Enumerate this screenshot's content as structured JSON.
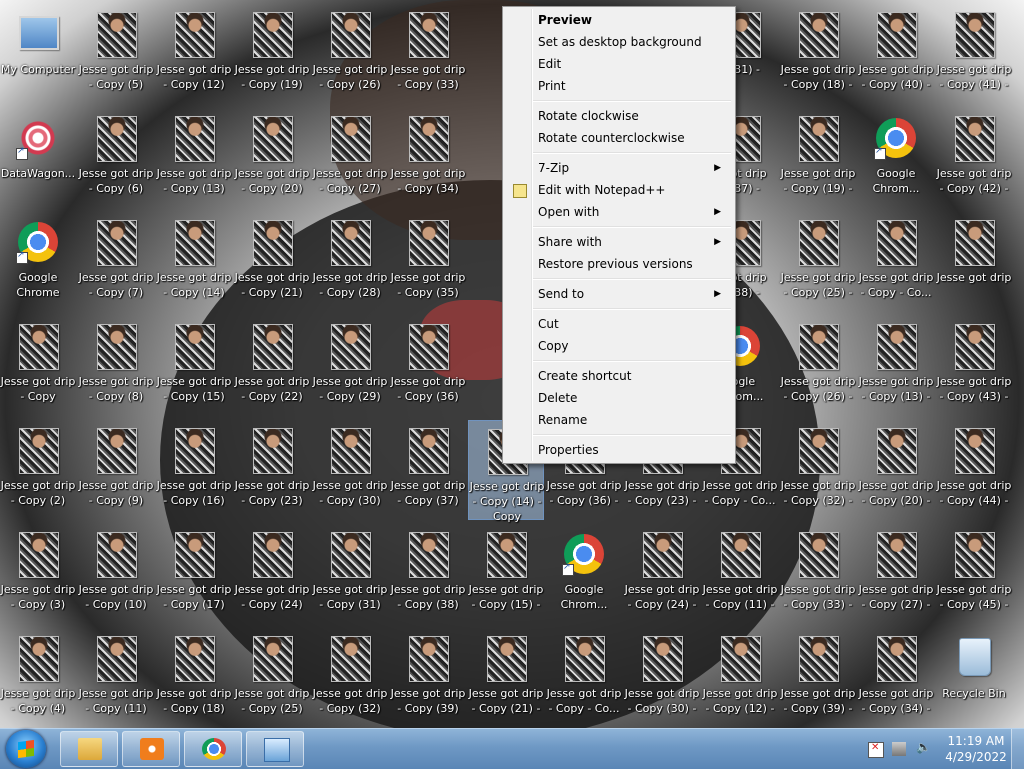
{
  "desktop": {
    "icons": [
      {
        "label": "My Computer",
        "kind": "pc",
        "col": 0,
        "row": 0
      },
      {
        "label": "DataWagon...",
        "kind": "dw",
        "col": 0,
        "row": 1,
        "shortcut": true
      },
      {
        "label": "Google\nChrome",
        "kind": "chrome",
        "col": 0,
        "row": 2,
        "shortcut": true
      },
      {
        "label": "Jesse got drip\n- Copy",
        "kind": "photo",
        "col": 0,
        "row": 3
      },
      {
        "label": "Jesse got drip\n- Copy (2)",
        "kind": "photo",
        "col": 0,
        "row": 4
      },
      {
        "label": "Jesse got drip\n- Copy (3)",
        "kind": "photo",
        "col": 0,
        "row": 5
      },
      {
        "label": "Jesse got drip\n- Copy (4)",
        "kind": "photo",
        "col": 0,
        "row": 6
      },
      {
        "label": "Jesse got drip\n- Copy (5)",
        "kind": "photo",
        "col": 1,
        "row": 0
      },
      {
        "label": "Jesse got drip\n- Copy (6)",
        "kind": "photo",
        "col": 1,
        "row": 1
      },
      {
        "label": "Jesse got drip\n- Copy (7)",
        "kind": "photo",
        "col": 1,
        "row": 2
      },
      {
        "label": "Jesse got drip\n- Copy (8)",
        "kind": "photo",
        "col": 1,
        "row": 3
      },
      {
        "label": "Jesse got drip\n- Copy (9)",
        "kind": "photo",
        "col": 1,
        "row": 4
      },
      {
        "label": "Jesse got drip\n- Copy (10)",
        "kind": "photo",
        "col": 1,
        "row": 5
      },
      {
        "label": "Jesse got drip\n- Copy (11)",
        "kind": "photo",
        "col": 1,
        "row": 6
      },
      {
        "label": "Jesse got drip\n- Copy (12)",
        "kind": "photo",
        "col": 2,
        "row": 0
      },
      {
        "label": "Jesse got drip\n- Copy (13)",
        "kind": "photo",
        "col": 2,
        "row": 1
      },
      {
        "label": "Jesse got drip\n- Copy (14)",
        "kind": "photo",
        "col": 2,
        "row": 2
      },
      {
        "label": "Jesse got drip\n- Copy (15)",
        "kind": "photo",
        "col": 2,
        "row": 3
      },
      {
        "label": "Jesse got drip\n- Copy (16)",
        "kind": "photo",
        "col": 2,
        "row": 4
      },
      {
        "label": "Jesse got drip\n- Copy (17)",
        "kind": "photo",
        "col": 2,
        "row": 5
      },
      {
        "label": "Jesse got drip\n- Copy (18)",
        "kind": "photo",
        "col": 2,
        "row": 6
      },
      {
        "label": "Jesse got drip\n- Copy (19)",
        "kind": "photo",
        "col": 3,
        "row": 0
      },
      {
        "label": "Jesse got drip\n- Copy (20)",
        "kind": "photo",
        "col": 3,
        "row": 1
      },
      {
        "label": "Jesse got drip\n- Copy (21)",
        "kind": "photo",
        "col": 3,
        "row": 2
      },
      {
        "label": "Jesse got drip\n- Copy (22)",
        "kind": "photo",
        "col": 3,
        "row": 3
      },
      {
        "label": "Jesse got drip\n- Copy (23)",
        "kind": "photo",
        "col": 3,
        "row": 4
      },
      {
        "label": "Jesse got drip\n- Copy (24)",
        "kind": "photo",
        "col": 3,
        "row": 5
      },
      {
        "label": "Jesse got drip\n- Copy (25)",
        "kind": "photo",
        "col": 3,
        "row": 6
      },
      {
        "label": "Jesse got drip\n- Copy (26)",
        "kind": "photo",
        "col": 4,
        "row": 0
      },
      {
        "label": "Jesse got drip\n- Copy (27)",
        "kind": "photo",
        "col": 4,
        "row": 1
      },
      {
        "label": "Jesse got drip\n- Copy (28)",
        "kind": "photo",
        "col": 4,
        "row": 2
      },
      {
        "label": "Jesse got drip\n- Copy (29)",
        "kind": "photo",
        "col": 4,
        "row": 3
      },
      {
        "label": "Jesse got drip\n- Copy (30)",
        "kind": "photo",
        "col": 4,
        "row": 4
      },
      {
        "label": "Jesse got drip\n- Copy (31)",
        "kind": "photo",
        "col": 4,
        "row": 5
      },
      {
        "label": "Jesse got drip\n- Copy (32)",
        "kind": "photo",
        "col": 4,
        "row": 6
      },
      {
        "label": "Jesse got drip\n- Copy (33)",
        "kind": "photo",
        "col": 5,
        "row": 0
      },
      {
        "label": "Jesse got drip\n- Copy (34)",
        "kind": "photo",
        "col": 5,
        "row": 1
      },
      {
        "label": "Jesse got drip\n- Copy (35)",
        "kind": "photo",
        "col": 5,
        "row": 2
      },
      {
        "label": "Jesse got drip\n- Copy (36)",
        "kind": "photo",
        "col": 5,
        "row": 3
      },
      {
        "label": "Jesse got drip\n- Copy (37)",
        "kind": "photo",
        "col": 5,
        "row": 4
      },
      {
        "label": "Jesse got drip\n- Copy (38)",
        "kind": "photo",
        "col": 5,
        "row": 5
      },
      {
        "label": "Jesse got drip\n- Copy (39)",
        "kind": "photo",
        "col": 5,
        "row": 6
      },
      {
        "label": "Jesse got drip\n- Copy (14) -\nCopy",
        "kind": "photo",
        "col": 6,
        "row": 4,
        "selected": true
      },
      {
        "label": "Jesse got drip\n- Copy (15) -",
        "kind": "photo",
        "col": 6,
        "row": 5
      },
      {
        "label": "Jesse got drip\n- Copy (21) -",
        "kind": "photo",
        "col": 6,
        "row": 6
      },
      {
        "label": "Jesse got drip\n- Copy (36) -",
        "kind": "photo",
        "col": 7,
        "row": 4
      },
      {
        "label": "Google\nChrom...",
        "kind": "chrome",
        "col": 7,
        "row": 5,
        "shortcut": true
      },
      {
        "label": "Jesse got drip\n- Copy - Co...",
        "kind": "photo",
        "col": 7,
        "row": 6
      },
      {
        "label": "Jesse got drip\n- Copy (23) -",
        "kind": "photo",
        "col": 8,
        "row": 4
      },
      {
        "label": "Jesse got drip\n- Copy (24) -",
        "kind": "photo",
        "col": 8,
        "row": 5
      },
      {
        "label": "Jesse got drip\n- Copy (30) -",
        "kind": "photo",
        "col": 8,
        "row": 6
      },
      {
        "label": "y (31) -",
        "kind": "photo",
        "col": 9,
        "row": 0
      },
      {
        "label": "e got drip\ny (37) -",
        "kind": "photo",
        "col": 9,
        "row": 1
      },
      {
        "label": "e got drip\ny (38) -",
        "kind": "photo",
        "col": 9,
        "row": 2
      },
      {
        "label": "oogle\nChrom...",
        "kind": "chrome",
        "col": 9,
        "row": 3
      },
      {
        "label": "Jesse got drip\n- Copy - Co...",
        "kind": "photo",
        "col": 9,
        "row": 4
      },
      {
        "label": "Jesse got drip\n- Copy (11) -",
        "kind": "photo",
        "col": 9,
        "row": 5
      },
      {
        "label": "Jesse got drip\n- Copy (12) -",
        "kind": "photo",
        "col": 9,
        "row": 6
      },
      {
        "label": "Jesse got drip\n- Copy (18) -",
        "kind": "photo",
        "col": 10,
        "row": 0
      },
      {
        "label": "Jesse got drip\n- Copy (19) -",
        "kind": "photo",
        "col": 10,
        "row": 1
      },
      {
        "label": "Jesse got drip\n- Copy (25) -",
        "kind": "photo",
        "col": 10,
        "row": 2
      },
      {
        "label": "Jesse got drip\n- Copy (26) -",
        "kind": "photo",
        "col": 10,
        "row": 3
      },
      {
        "label": "Jesse got drip\n- Copy (32) -",
        "kind": "photo",
        "col": 10,
        "row": 4
      },
      {
        "label": "Jesse got drip\n- Copy (33) -",
        "kind": "photo",
        "col": 10,
        "row": 5
      },
      {
        "label": "Jesse got drip\n- Copy (39) -",
        "kind": "photo",
        "col": 10,
        "row": 6
      },
      {
        "label": "Jesse got drip\n- Copy (40) -",
        "kind": "photo",
        "col": 11,
        "row": 0
      },
      {
        "label": "Google\nChrom...",
        "kind": "chrome",
        "col": 11,
        "row": 1,
        "shortcut": true
      },
      {
        "label": "Jesse got drip\n- Copy - Co...",
        "kind": "photo",
        "col": 11,
        "row": 2
      },
      {
        "label": "Jesse got drip\n- Copy (13) -",
        "kind": "photo",
        "col": 11,
        "row": 3
      },
      {
        "label": "Jesse got drip\n- Copy (20) -",
        "kind": "photo",
        "col": 11,
        "row": 4
      },
      {
        "label": "Jesse got drip\n- Copy (27) -",
        "kind": "photo",
        "col": 11,
        "row": 5
      },
      {
        "label": "Jesse got drip\n- Copy (34) -",
        "kind": "photo",
        "col": 11,
        "row": 6
      },
      {
        "label": "Jesse got drip\n- Copy (41) -",
        "kind": "photo",
        "col": 12,
        "row": 0
      },
      {
        "label": "Jesse got drip\n- Copy (42) -",
        "kind": "photo",
        "col": 12,
        "row": 1
      },
      {
        "label": "Jesse got drip",
        "kind": "photo",
        "col": 12,
        "row": 2
      },
      {
        "label": "Jesse got drip\n- Copy (43) -",
        "kind": "photo",
        "col": 12,
        "row": 3
      },
      {
        "label": "Jesse got drip\n- Copy (44) -",
        "kind": "photo",
        "col": 12,
        "row": 4
      },
      {
        "label": "Jesse got drip\n- Copy (45) -",
        "kind": "photo",
        "col": 12,
        "row": 5
      },
      {
        "label": "Recycle Bin",
        "kind": "bin",
        "col": 12,
        "row": 6
      }
    ]
  },
  "context_menu": {
    "items": [
      {
        "label": "Preview",
        "bold": true
      },
      {
        "label": "Set as desktop background"
      },
      {
        "label": "Edit"
      },
      {
        "label": "Print"
      },
      {
        "sep": true
      },
      {
        "label": "Rotate clockwise"
      },
      {
        "label": "Rotate counterclockwise"
      },
      {
        "sep": true
      },
      {
        "label": "7-Zip",
        "submenu": true
      },
      {
        "label": "Edit with Notepad++",
        "icon": "notepad-plus-plus-icon"
      },
      {
        "label": "Open with",
        "submenu": true
      },
      {
        "sep": true
      },
      {
        "label": "Share with",
        "submenu": true
      },
      {
        "label": "Restore previous versions"
      },
      {
        "sep": true
      },
      {
        "label": "Send to",
        "submenu": true
      },
      {
        "sep": true
      },
      {
        "label": "Cut"
      },
      {
        "label": "Copy"
      },
      {
        "sep": true
      },
      {
        "label": "Create shortcut"
      },
      {
        "label": "Delete"
      },
      {
        "label": "Rename"
      },
      {
        "sep": true
      },
      {
        "label": "Properties"
      }
    ]
  },
  "taskbar": {
    "pinned": [
      "windows-explorer-icon",
      "media-player-icon",
      "chrome-icon",
      "control-panel-icon"
    ],
    "clock": {
      "time": "11:19 AM",
      "date": "4/29/2022"
    }
  }
}
